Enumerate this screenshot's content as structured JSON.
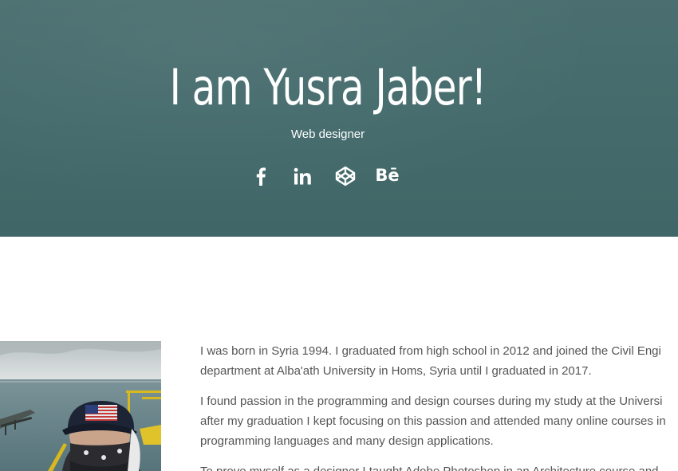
{
  "hero": {
    "title": "I am Yusra Jaber!",
    "subtitle": "Web designer",
    "background_color": "#466b6c",
    "social": [
      {
        "icon": "facebook-icon"
      },
      {
        "icon": "linkedin-icon"
      },
      {
        "icon": "codepen-icon"
      },
      {
        "icon": "behance-icon",
        "label": "Bē"
      }
    ]
  },
  "about": {
    "photo_icon": "profile-photo",
    "paragraphs": [
      {
        "line1": "I was born in Syria 1994. I graduated from high school in 2012 and joined the Civil Engi",
        "line2": "department at Alba'ath University in Homs, Syria until I graduated in 2017."
      },
      {
        "line1": "I found passion in the programming and design courses during my study at the Universi",
        "line2": "after my graduation I kept focusing on this passion and attended many online courses in",
        "line3": "programming languages and many design applications."
      },
      {
        "line1": "To prove myself as a designer I taught Adobe Photoshop in an Architecture course and"
      }
    ]
  }
}
